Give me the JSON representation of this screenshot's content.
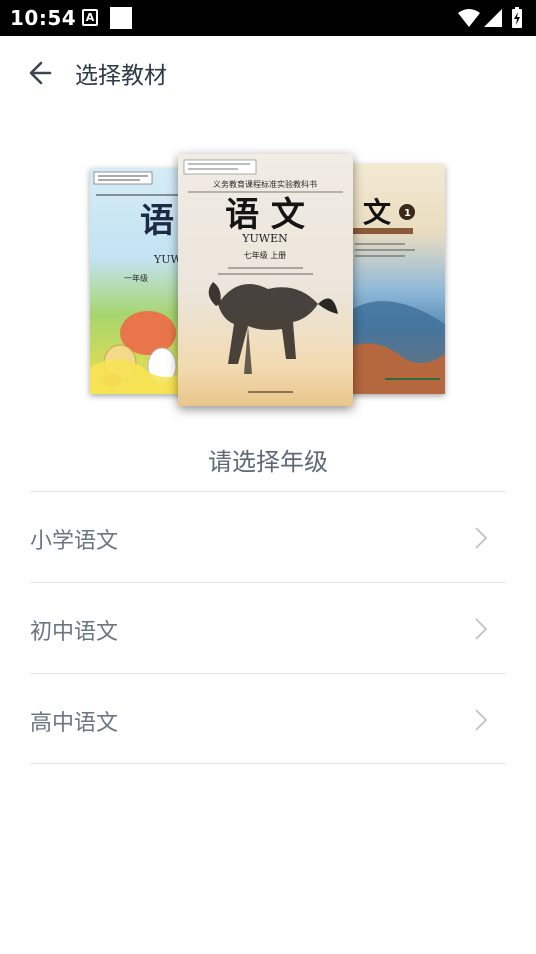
{
  "status_bar": {
    "time": "10:54",
    "icons": [
      "keyboard-a-icon",
      "blank-square-icon",
      "wifi-icon",
      "signal-icon",
      "battery-charging-icon"
    ]
  },
  "toolbar": {
    "back_icon": "arrow-left-icon",
    "title": "选择教材"
  },
  "books": {
    "left": {
      "title_char": "语",
      "romanization": "YUWEN",
      "grade": "一年级"
    },
    "center": {
      "series": "义务教育课程标准实验教科书",
      "title": "语 文",
      "romanization": "YUWEN",
      "grade": "七年级 上册"
    },
    "right": {
      "title_char": "文",
      "volume": "1"
    }
  },
  "section": {
    "heading": "请选择年级"
  },
  "grades": [
    {
      "label": "小学语文"
    },
    {
      "label": "初中语文"
    },
    {
      "label": "高中语文"
    }
  ],
  "colors": {
    "title_text": "#2e3a45",
    "list_text": "#6b7681",
    "divider": "#e4e4e4",
    "chevron": "#c2c2c2"
  }
}
